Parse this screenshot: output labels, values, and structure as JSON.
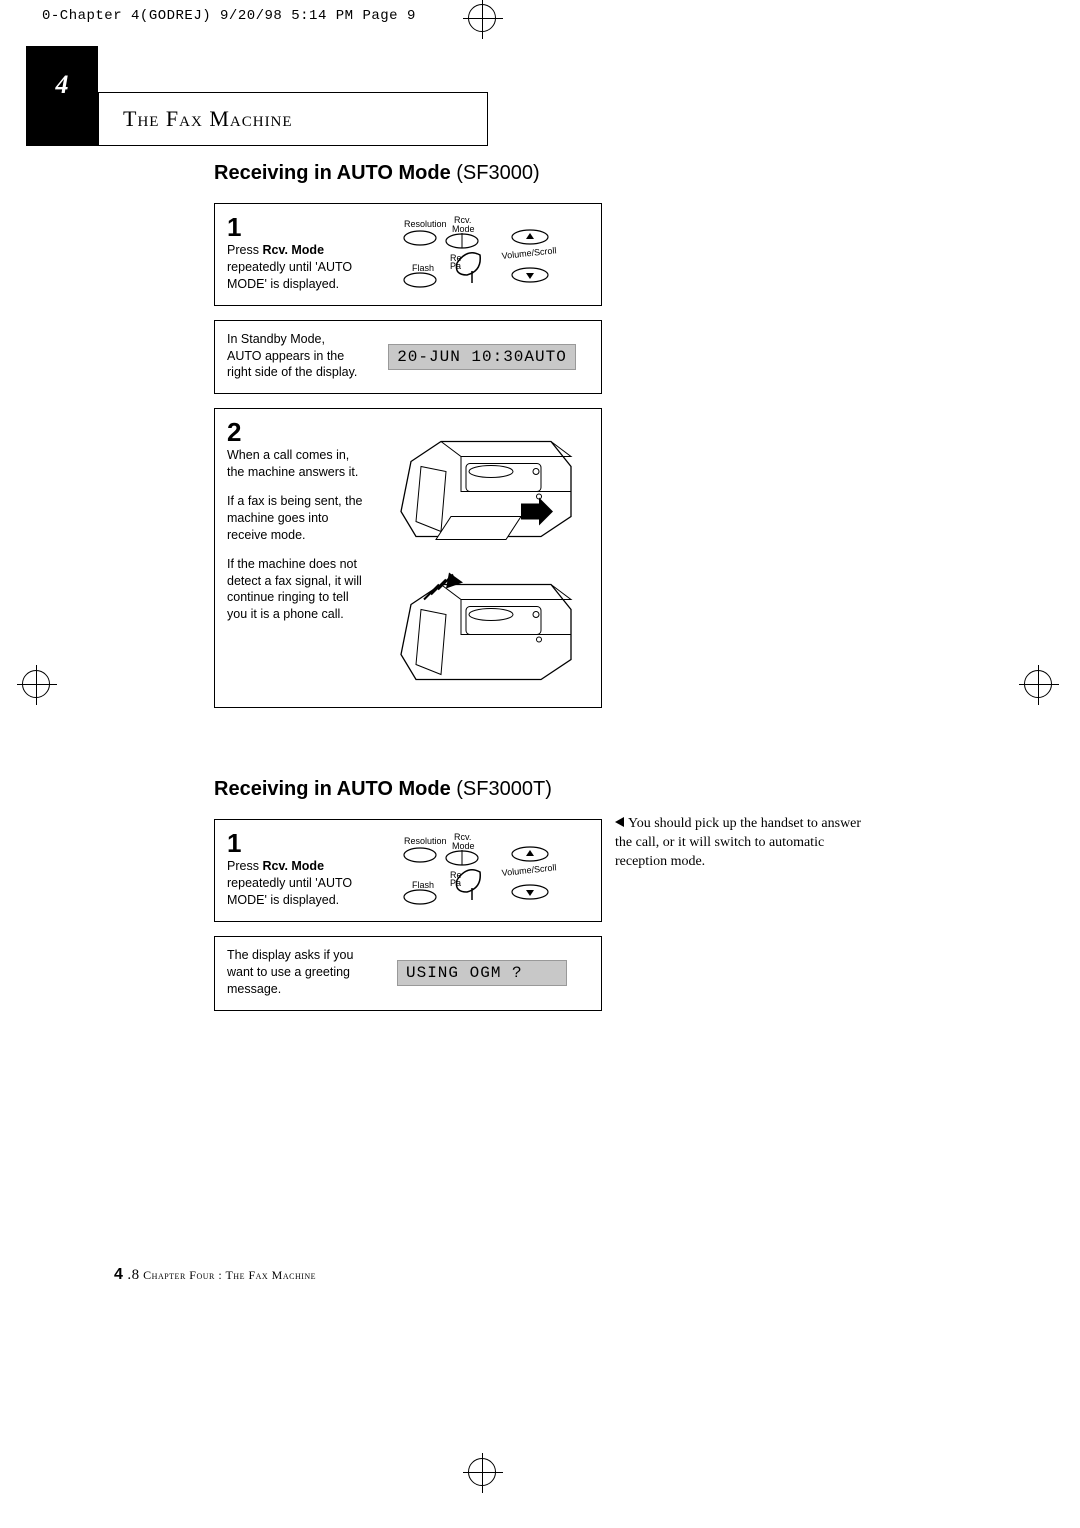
{
  "slug": "0-Chapter 4(GODREJ)  9/20/98  5:14 PM  Page 9",
  "tab_number": "4",
  "chapter_title": "The Fax Machine",
  "section1": {
    "title": "Receiving in AUTO Mode",
    "model": "(SF3000)",
    "step1_num": "1",
    "step1_prefix": "Press ",
    "step1_bold": "Rcv. Mode",
    "step1_suffix": " repeatedly until 'AUTO MODE' is displayed.",
    "panel_labels": {
      "resolution": "Resolution",
      "rcv_mode": "Rcv.\nMode",
      "flash": "Flash",
      "redial_pause": "Re\nPa",
      "volume": "Volume/Scroll"
    },
    "standby_text": "In Standby Mode, AUTO appears in the right side of the display.",
    "lcd1": "20-JUN 10:30AUTO",
    "step2_num": "2",
    "step2_p1": "When a call comes in, the machine answers it.",
    "step2_p2": "If a fax is being sent, the machine goes into receive mode.",
    "step2_p3": "If the machine does not detect a fax signal, it will continue ringing to tell you it is a phone call.",
    "side_note": "You should pick up the handset to answer the call, or it will switch to automatic reception mode."
  },
  "section2": {
    "title": "Receiving in AUTO Mode",
    "model": "(SF3000T)",
    "step1_num": "1",
    "step1_prefix": "Press ",
    "step1_bold": "Rcv. Mode",
    "step1_suffix": " repeatedly until 'AUTO MODE' is displayed.",
    "display_text": "The display asks if you want to use a greeting message.",
    "lcd2": "USING OGM ?"
  },
  "footer": {
    "page_num": "4",
    "page_sub": ".8",
    "text": " Chapter Four : The Fax Machine"
  }
}
